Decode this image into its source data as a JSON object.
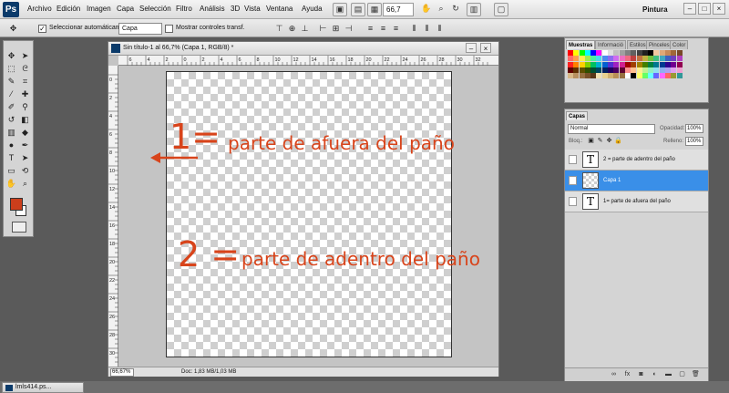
{
  "app": {
    "logo": "Ps",
    "menu": [
      "Archivo",
      "Edición",
      "Imagen",
      "Capa",
      "Selección",
      "Filtro",
      "Análisis",
      "3D",
      "Vista",
      "Ventana",
      "Ayuda"
    ],
    "zoom": "66,7",
    "workspace": "Pintura"
  },
  "options_bar": {
    "auto_select_label": "Seleccionar automáticamente:",
    "auto_select_value": "Capa",
    "show_transform_label": "Mostrar controles transf."
  },
  "document": {
    "title": "Sin título-1 al 66,7% (Capa 1, RGB/8) *",
    "zoom_status": "66,67%",
    "doc_info": "Doc: 1,83 MB/1,03 MB",
    "ruler_top": [
      "6",
      "4",
      "2",
      "0",
      "2",
      "4",
      "6",
      "8",
      "10",
      "12",
      "14",
      "16",
      "18",
      "20",
      "22",
      "24",
      "26",
      "28",
      "30",
      "32"
    ],
    "ruler_left": [
      "0",
      "2",
      "4",
      "6",
      "8",
      "10",
      "12",
      "14",
      "16",
      "18",
      "20",
      "22",
      "24",
      "26",
      "28",
      "30"
    ]
  },
  "annotations": {
    "a1_num": "1=",
    "a1_text": "parte de afuera del paño",
    "a2_num": "2 =",
    "a2_text": "parte de adentro del paño"
  },
  "swatch_panel": {
    "tabs": [
      "Muestras",
      "Informació",
      "Estilos",
      "Pinceles",
      "Color"
    ],
    "colors": [
      "#ff0000",
      "#ffff00",
      "#00ff00",
      "#00ffff",
      "#0000ff",
      "#ff00ff",
      "#ffffff",
      "#e0e0e0",
      "#c0c0c0",
      "#a0a0a0",
      "#808080",
      "#606060",
      "#404040",
      "#202020",
      "#000000",
      "#f2c8a0",
      "#e0a878",
      "#c88858",
      "#a06838",
      "#784828",
      "#ff6a6a",
      "#ffa04c",
      "#fff04c",
      "#9cf04c",
      "#4cf0a0",
      "#4cd8f0",
      "#4c8cf0",
      "#8c6cf0",
      "#d06cf0",
      "#f06cc0",
      "#f06c80",
      "#c04040",
      "#c07040",
      "#c0b040",
      "#70c040",
      "#40c080",
      "#40a8c0",
      "#4060c0",
      "#7040c0",
      "#b040c0",
      "#ff2020",
      "#ff8000",
      "#ffd000",
      "#80d000",
      "#00c060",
      "#00b0d0",
      "#0060d0",
      "#5030d0",
      "#a020c0",
      "#d02090",
      "#a00000",
      "#a04000",
      "#a08000",
      "#408000",
      "#008040",
      "#007890",
      "#003890",
      "#300090",
      "#700090",
      "#900050",
      "#600000",
      "#603000",
      "#605000",
      "#305000",
      "#005030",
      "#004860",
      "#002060",
      "#200060",
      "#480060",
      "#600030",
      "#ff9090",
      "#ffc090",
      "#fff090",
      "#c0f090",
      "#90f0c0",
      "#90e0f0",
      "#90b0f0",
      "#b0a0f0",
      "#e0a0f0",
      "#f0a0d0",
      "#d8b888",
      "#b89060",
      "#987040",
      "#785028",
      "#583818",
      "#f0e0b0",
      "#e8d090",
      "#d0b070",
      "#b89058",
      "#987040",
      "#ffffff",
      "#000000",
      "#ffff66",
      "#66ff66",
      "#66ffff",
      "#6666ff",
      "#ff66ff",
      "#ff6666",
      "#999933",
      "#339999"
    ]
  },
  "layers_panel": {
    "tabs": [
      "Capas"
    ],
    "blend_mode": "Normal",
    "opacity_label": "Opacidad:",
    "opacity_value": "100%",
    "lock_label": "Bloq.:",
    "fill_label": "Relleno:",
    "fill_value": "100%",
    "layers": [
      {
        "name": "2 = parte de adentro del paño",
        "thumb": "T",
        "selected": false
      },
      {
        "name": "Capa 1",
        "thumb": "",
        "selected": true
      },
      {
        "name": "1= parte de afuera del paño",
        "thumb": "T",
        "selected": false
      }
    ],
    "footer_icons": [
      "link-icon",
      "fx-icon",
      "mask-icon",
      "adjustment-icon",
      "group-icon",
      "new-layer-icon",
      "trash-icon"
    ]
  },
  "taskbar": {
    "item": "lmls414.ps..."
  }
}
